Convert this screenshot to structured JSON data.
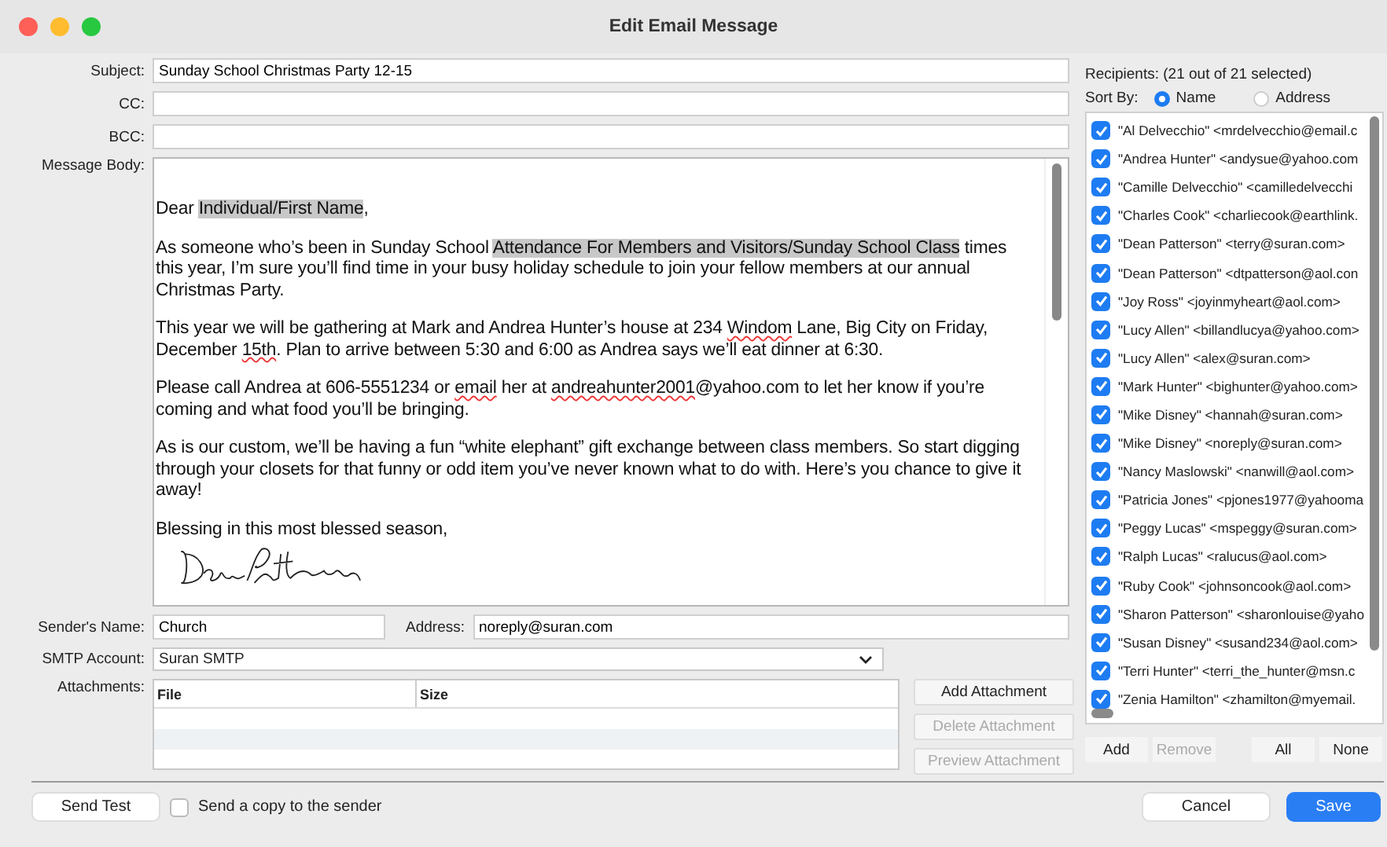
{
  "window": {
    "title": "Edit Email Message"
  },
  "fields": [
    {
      "label": "Subject:",
      "value": "Sunday School Christmas Party 12-15"
    },
    {
      "label": "CC:"
    },
    {
      "label": "BCC:"
    }
  ],
  "message_body": {
    "label": "Message Body:",
    "paragraphs": [
      [
        {
          "kind": "plain",
          "text": "Dear "
        },
        {
          "kind": "field",
          "text": "Individual/First Name"
        },
        {
          "kind": "plain",
          "text": ","
        }
      ],
      [
        {
          "kind": "plain",
          "text": "As someone who’s been in Sunday School "
        },
        {
          "kind": "field",
          "text": "Attendance For Members and Visitors/Sunday School Class"
        },
        {
          "kind": "plain",
          "text": " times this year, I’m sure you’ll find time in your busy holiday schedule to join your fellow members at our annual Christmas Party."
        }
      ],
      [
        {
          "kind": "plain",
          "text": "This year we will be gathering at Mark and Andrea Hunter’s house at 234 "
        },
        {
          "kind": "misspelled",
          "text": "Windom"
        },
        {
          "kind": "plain",
          "text": " Lane, Big City on Friday, December "
        },
        {
          "kind": "misspelled",
          "text": "15th"
        },
        {
          "kind": "plain",
          "text": ". Plan to arrive between 5:30 and 6:00 as Andrea says we’ll eat dinner at 6:30."
        }
      ],
      [
        {
          "kind": "plain",
          "text": "Please call Andrea at 606-5551234 or "
        },
        {
          "kind": "misspelled",
          "text": "email"
        },
        {
          "kind": "plain",
          "text": " her at "
        },
        {
          "kind": "misspelled",
          "text": "andreahunter2001"
        },
        {
          "kind": "plain",
          "text": "@yahoo.com to let her know if you’re coming and what food you’ll be bringing."
        }
      ],
      [
        {
          "kind": "plain",
          "text": "As is our custom, we’ll be having a fun “white elephant” gift exchange between class members. So start digging through your closets for that funny or odd item you’ve never known what to do with. Here’s you chance to give it away!"
        }
      ],
      [
        {
          "kind": "plain",
          "text": "Blessing in this most blessed season,"
        }
      ]
    ]
  },
  "sender": {
    "name_label": "Sender's Name:",
    "name": "Church",
    "address_label": "Address:",
    "address": "noreply@suran.com"
  },
  "smtp": {
    "label": "SMTP Account:",
    "value": "Suran SMTP"
  },
  "attachments": {
    "label": "Attachments:",
    "columns": [
      "File",
      "Size"
    ],
    "buttons": [
      {
        "label": "Add Attachment",
        "disabled": false
      },
      {
        "label": "Delete Attachment",
        "disabled": true
      },
      {
        "label": "Preview Attachment",
        "disabled": true
      }
    ]
  },
  "recipients": {
    "heading": "Recipients: (21 out of 21 selected)",
    "sort_label": "Sort By:",
    "sort_options": [
      {
        "label": "Name",
        "selected": true
      },
      {
        "label": "Address",
        "selected": false
      }
    ],
    "items": [
      {
        "label": "\"Al Delvecchio\" <mrdelvecchio@email.c",
        "checked": true
      },
      {
        "label": "\"Andrea Hunter\" <andysue@yahoo.com",
        "checked": true
      },
      {
        "label": "\"Camille Delvecchio\" <camilledelvecchi",
        "checked": true
      },
      {
        "label": "\"Charles Cook\" <charliecook@earthlink.",
        "checked": true
      },
      {
        "label": "\"Dean Patterson\" <terry@suran.com>",
        "checked": true
      },
      {
        "label": "\"Dean Patterson\" <dtpatterson@aol.con",
        "checked": true
      },
      {
        "label": "\"Joy Ross\" <joyinmyheart@aol.com>",
        "checked": true
      },
      {
        "label": "\"Lucy Allen\" <billandlucya@yahoo.com>",
        "checked": true
      },
      {
        "label": "\"Lucy Allen\" <alex@suran.com>",
        "checked": true
      },
      {
        "label": "\"Mark Hunter\" <bighunter@yahoo.com>",
        "checked": true
      },
      {
        "label": "\"Mike Disney\" <hannah@suran.com>",
        "checked": true
      },
      {
        "label": "\"Mike Disney\" <noreply@suran.com>",
        "checked": true
      },
      {
        "label": "\"Nancy Maslowski\" <nanwill@aol.com>",
        "checked": true
      },
      {
        "label": "\"Patricia Jones\" <pjones1977@yahooma",
        "checked": true
      },
      {
        "label": "\"Peggy Lucas\" <mspeggy@suran.com>",
        "checked": true
      },
      {
        "label": "\"Ralph Lucas\" <ralucus@aol.com>",
        "checked": true
      },
      {
        "label": "\"Ruby Cook\" <johnsoncook@aol.com>",
        "checked": true
      },
      {
        "label": "\"Sharon Patterson\" <sharonlouise@yaho",
        "checked": true
      },
      {
        "label": "\"Susan Disney\" <susand234@aol.com>",
        "checked": true
      },
      {
        "label": "\"Terri Hunter\" <terri_the_hunter@msn.c",
        "checked": true
      },
      {
        "label": "\"Zenia Hamilton\" <zhamilton@myemail.",
        "checked": true
      }
    ],
    "buttons": [
      {
        "label": "Add",
        "disabled": false
      },
      {
        "label": "Remove",
        "disabled": true
      },
      {
        "label": "All",
        "disabled": false
      },
      {
        "label": "None",
        "disabled": false
      }
    ]
  },
  "footer": {
    "send_test": "Send Test",
    "copy_label": "Send a copy to the sender",
    "copy_checked": false,
    "cancel": "Cancel",
    "save": "Save"
  }
}
